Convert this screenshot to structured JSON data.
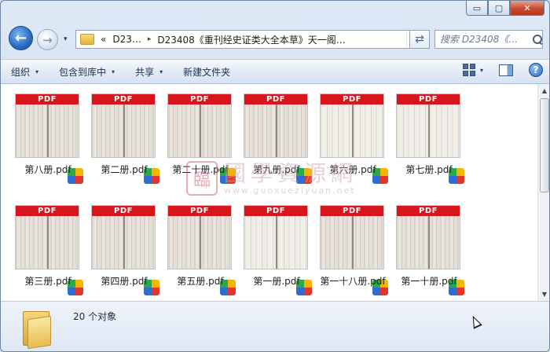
{
  "window": {
    "caption_buttons": {
      "minimize": "▭",
      "maximize": "▢",
      "close": "✕"
    }
  },
  "address_bar": {
    "overflow_chevron": "«",
    "crumbs": [
      "D23…",
      "D23408《重刊经史证类大全本草》天一阁…"
    ],
    "separator": "▸",
    "dropdown": "▾",
    "refresh_glyph": "⇄"
  },
  "search": {
    "placeholder": "搜索 D23408《…"
  },
  "toolbar": {
    "items": [
      {
        "label": "组织",
        "has_dropdown": true
      },
      {
        "label": "包含到库中",
        "has_dropdown": true
      },
      {
        "label": "共享",
        "has_dropdown": true
      },
      {
        "label": "新建文件夹",
        "has_dropdown": false
      }
    ],
    "dropdown_glyph": "▾",
    "help_glyph": "?"
  },
  "files": [
    {
      "name": "第八册.pdf",
      "badge": "PDF"
    },
    {
      "name": "第二册.pdf",
      "badge": "PDF"
    },
    {
      "name": "第二十册.pdf",
      "badge": "PDF"
    },
    {
      "name": "第九册.pdf",
      "badge": "PDF"
    },
    {
      "name": "第六册.pdf",
      "badge": "PDF"
    },
    {
      "name": "第七册.pdf",
      "badge": "PDF"
    },
    {
      "name": "第三册.pdf",
      "badge": "PDF"
    },
    {
      "name": "第四册.pdf",
      "badge": "PDF"
    },
    {
      "name": "第五册.pdf",
      "badge": "PDF"
    },
    {
      "name": "第一册.pdf",
      "badge": "PDF"
    },
    {
      "name": "第一十八册.pdf",
      "badge": "PDF"
    },
    {
      "name": "第一十册.pdf",
      "badge": "PDF"
    }
  ],
  "watermark": {
    "seal": "臨",
    "text": "國學資源網",
    "url": "www.guoxueziyuan.net"
  },
  "status": {
    "count_text": "20 个对象"
  },
  "scrollbar": {
    "up": "▲",
    "down": "▼"
  }
}
